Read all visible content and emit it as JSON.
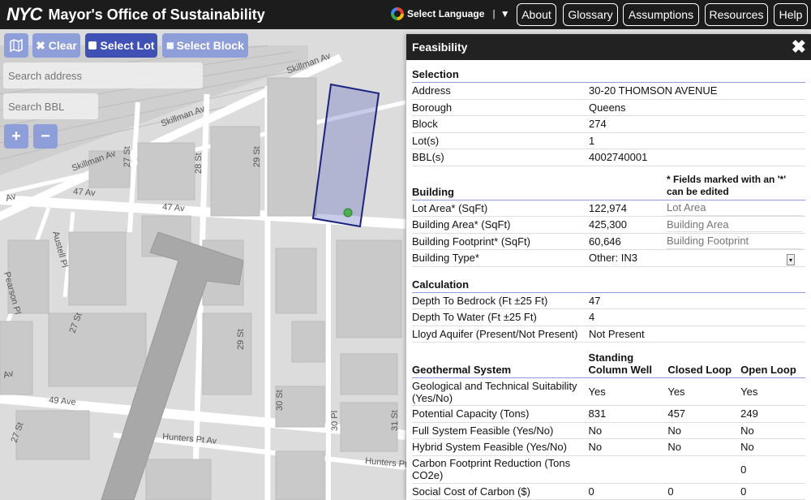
{
  "header": {
    "logo": "NYC",
    "title": "Mayor's Office of Sustainability",
    "language": "Select Language",
    "language_separator": "|",
    "language_caret": "▼",
    "nav": [
      "About",
      "Glossary",
      "Assumptions",
      "Resources",
      "Help"
    ]
  },
  "controls": {
    "clear": "✖ Clear",
    "select_lot": "Select Lot",
    "select_block": "Select Block",
    "search_address_placeholder": "Search address",
    "search_bbl_placeholder": "Search BBL",
    "zoom_in": "+",
    "zoom_out": "−"
  },
  "map_labels": {
    "skillman1": "Skillman Av",
    "skillman2": "Skillman Av",
    "skillman3": "Skillman Av",
    "ave47a": "47 Av",
    "ave47b": "47 Av",
    "st27": "27 St",
    "st28": "28 St",
    "st29a": "29 St",
    "st29b": "29 St",
    "st27b": "27 St",
    "st27c": "27 St",
    "austell": "Austell Pl",
    "pearson": "Pearson Pl",
    "ave49": "49 Ave",
    "hunters1": "Hunters Pt Av",
    "hunters2": "Hunters Pt Av",
    "st30": "30 St",
    "pl30": "30 Pl",
    "st31": "31 St",
    "av": "Av",
    "av2": "Av"
  },
  "panel": {
    "title": "Feasibility",
    "selection": {
      "title": "Selection",
      "rows": [
        {
          "label": "Address",
          "value": "30-20 THOMSON AVENUE"
        },
        {
          "label": "Borough",
          "value": "Queens"
        },
        {
          "label": "Block",
          "value": "274"
        },
        {
          "label": "Lot(s)",
          "value": "1"
        },
        {
          "label": "BBL(s)",
          "value": "4002740001"
        }
      ]
    },
    "building": {
      "title": "Building",
      "note_line1": "* Fields marked with an '*'",
      "note_line2": "can be edited",
      "rows": [
        {
          "label": "Lot Area* (SqFt)",
          "value": "122,974",
          "placeholder": "Lot Area"
        },
        {
          "label": "Building Area* (SqFt)",
          "value": "425,300",
          "placeholder": "Building Area"
        },
        {
          "label": "Building Footprint* (SqFt)",
          "value": "60,646",
          "placeholder": "Building Footprint"
        }
      ],
      "type_label": "Building Type*",
      "type_value": "Other: IN3"
    },
    "calculation": {
      "title": "Calculation",
      "rows": [
        {
          "label": "Depth To Bedrock (Ft ±25 Ft)",
          "value": "47"
        },
        {
          "label": "Depth To Water (Ft ±25 Ft)",
          "value": "4"
        },
        {
          "label": "Lloyd Aquifer (Present/Not Present)",
          "value": "Not Present"
        }
      ]
    },
    "geothermal": {
      "title": "Geothermal System",
      "col1_line1": "Standing",
      "col1_line2": "Column Well",
      "col2": "Closed Loop",
      "col3": "Open Loop",
      "suitability_line1": "Geological and Technical Suitability",
      "suitability_line2": "(Yes/No)",
      "suitability": [
        "Yes",
        "Yes",
        "Yes"
      ],
      "rows": [
        {
          "label": "Potential Capacity (Tons)",
          "v": [
            "831",
            "457",
            "249"
          ]
        },
        {
          "label": "Full System Feasible (Yes/No)",
          "v": [
            "No",
            "No",
            "No"
          ]
        },
        {
          "label": "Hybrid System Feasible (Yes/No)",
          "v": [
            "No",
            "No",
            "No"
          ]
        }
      ],
      "carbon_line1": "Carbon Footprint Reduction (Tons",
      "carbon_line2": "CO2e)",
      "carbon": [
        "",
        "",
        "0"
      ],
      "social": "Social Cost of Carbon ($)",
      "social_v": [
        "0",
        "0",
        "0"
      ]
    }
  }
}
